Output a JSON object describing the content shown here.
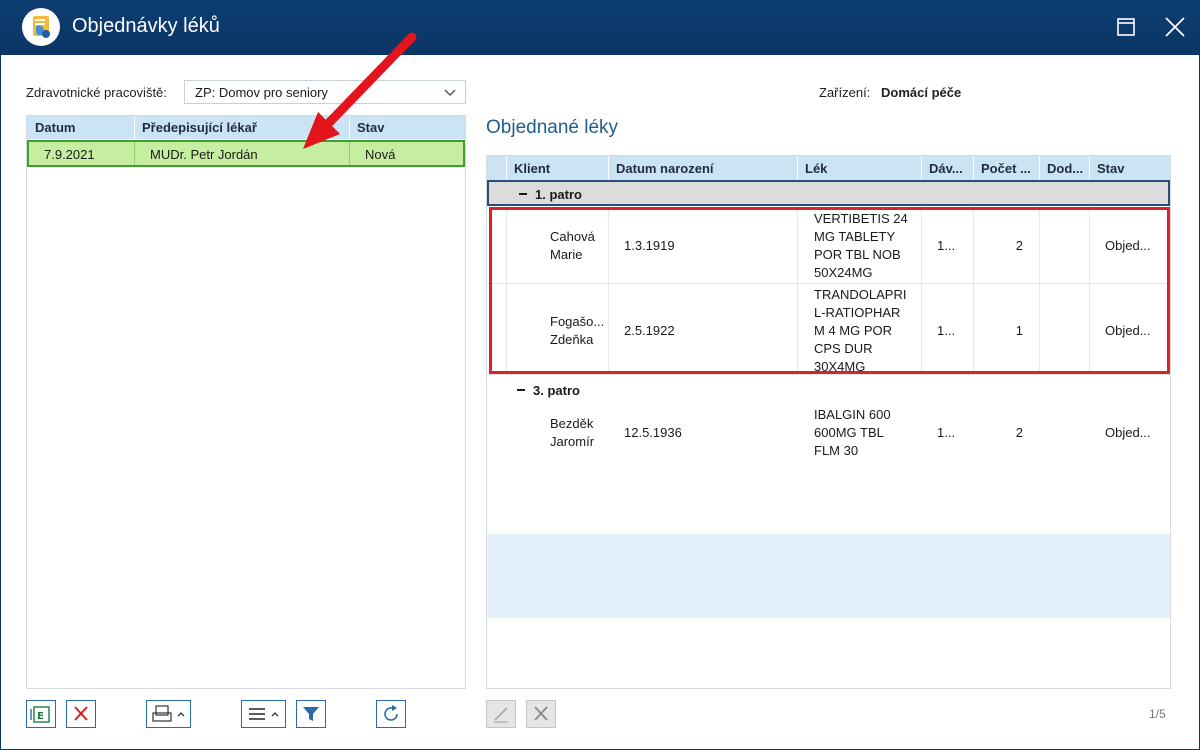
{
  "window": {
    "title": "Objednávky léků",
    "icons": {
      "app": "pharmacy-app-icon",
      "maximize": "maximize-icon",
      "close": "close-icon"
    }
  },
  "filters": {
    "workplace_label": "Zdravotnické pracoviště:",
    "workplace_value": "ZP: Domov pro seniory",
    "facility_label": "Zařízení:",
    "facility_value": "Domácí péče"
  },
  "orders_table": {
    "columns": [
      "Datum",
      "Předepisující lékař",
      "Stav"
    ],
    "rows": [
      {
        "date": "7.9.2021",
        "doctor": "MUDr. Petr Jordán",
        "status": "Nová"
      }
    ]
  },
  "ordered_drugs": {
    "title": "Objednané léky",
    "columns": [
      "Klient",
      "Datum narození",
      "Lék",
      "Dáv...",
      "Počet ...",
      "Dod...",
      "Stav"
    ],
    "groups": [
      {
        "label": "1. patro",
        "rows": [
          {
            "client": [
              "Cahová",
              "Marie"
            ],
            "birth": "1.3.1919",
            "drug": [
              "VERTIBETIS 24",
              "MG TABLETY",
              "POR TBL NOB",
              "50X24MG"
            ],
            "dose": "1...",
            "count": "2",
            "delivered": "",
            "status": "Objed..."
          },
          {
            "client": [
              "Fogašo...",
              "Zdeňka"
            ],
            "birth": "2.5.1922",
            "drug": [
              "TRANDOLAPRI",
              "L-RATIOPHAR",
              "M 4 MG POR",
              "CPS DUR",
              "30X4MG"
            ],
            "dose": "1...",
            "count": "1",
            "delivered": "",
            "status": "Objed..."
          }
        ]
      },
      {
        "label": "3. patro",
        "rows": [
          {
            "client": [
              "Bezděk",
              "Jaromír"
            ],
            "birth": "12.5.1936",
            "drug": [
              "IBALGIN 600",
              "600MG TBL",
              "FLM 30"
            ],
            "dose": "1...",
            "count": "2",
            "delivered": "",
            "status": "Objed..."
          }
        ]
      }
    ],
    "pager": "1/5"
  },
  "toolbar_icons": {
    "excel": "excel-export-icon",
    "delete": "delete-icon",
    "print": "print-icon",
    "menu": "menu-icon",
    "filter": "filter-icon",
    "refresh": "refresh-icon",
    "edit": "edit-icon",
    "remove": "remove-icon"
  },
  "colors": {
    "titlebar": "#0a3666",
    "header": "#cbe4f3",
    "selected_row": "#c5eea0",
    "selected_border": "#3fa12b",
    "annotation": "#d9232b"
  }
}
